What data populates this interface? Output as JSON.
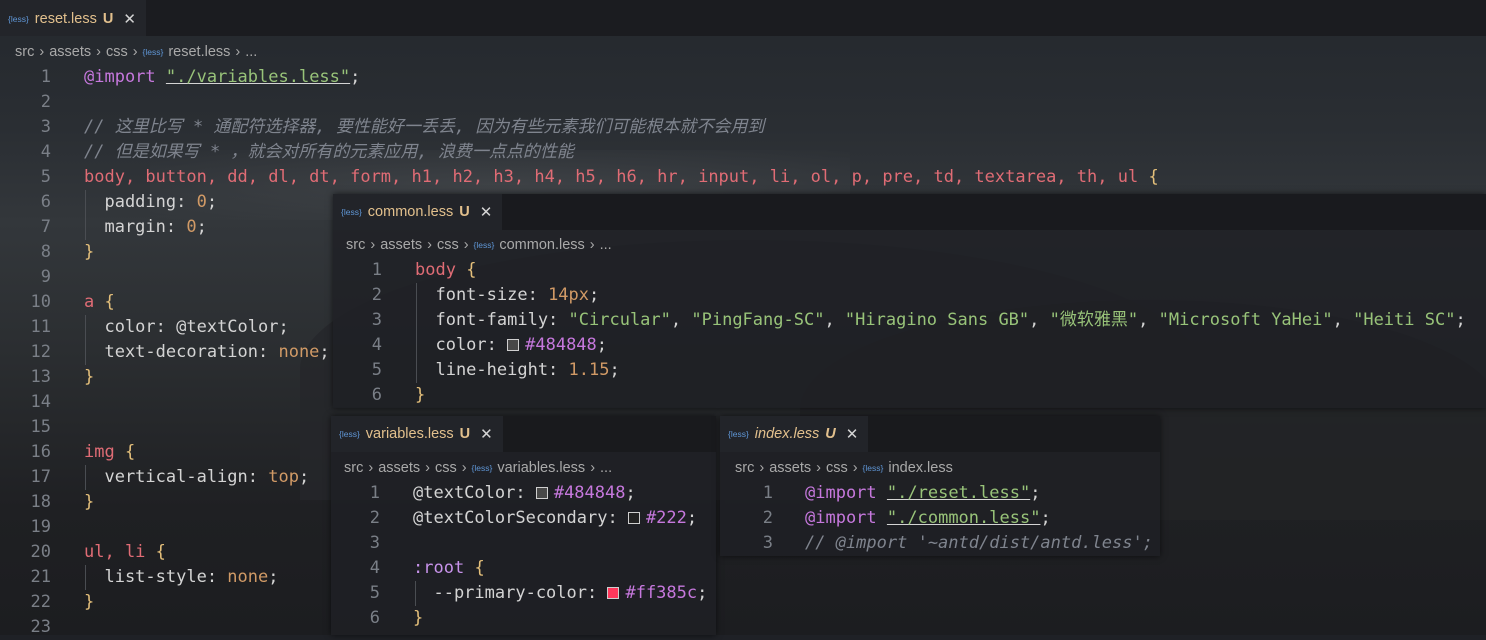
{
  "editors": {
    "main": {
      "tab": {
        "badge": "{less}",
        "name": "reset.less",
        "status": "U",
        "close": "✕"
      },
      "breadcrumb": [
        "src",
        "assets",
        "css",
        "reset.less",
        "..."
      ],
      "lines": [
        {
          "n": "1",
          "code": [
            [
              "at",
              "@import"
            ],
            [
              "p",
              " "
            ],
            [
              "s",
              "\"./variables.less\""
            ],
            [
              "p",
              ";"
            ]
          ]
        },
        {
          "n": "2",
          "code": []
        },
        {
          "n": "3",
          "code": [
            [
              "c",
              "// 这里比写 * 通配符选择器, 要性能好一丢丢, 因为有些元素我们可能根本就不会用到"
            ]
          ]
        },
        {
          "n": "4",
          "code": [
            [
              "c",
              "// 但是如果写 * ，就会对所有的元素应用, 浪费一点点的性能"
            ]
          ]
        },
        {
          "n": "5",
          "code": [
            [
              "k",
              "body, button, dd, dl, dt, form, h1, h2, h3, h4, h5, h6, hr, input, li, ol, p, pre, td, textarea, th, ul"
            ],
            [
              "p",
              " "
            ],
            [
              "b",
              "{"
            ]
          ]
        },
        {
          "n": "6",
          "code": [
            [
              "p",
              "  padding: "
            ],
            [
              "n",
              "0"
            ],
            [
              "p",
              ";"
            ]
          ]
        },
        {
          "n": "7",
          "code": [
            [
              "p",
              "  margin: "
            ],
            [
              "n",
              "0"
            ],
            [
              "p",
              ";"
            ]
          ]
        },
        {
          "n": "8",
          "code": [
            [
              "b",
              "}"
            ]
          ]
        },
        {
          "n": "9",
          "code": []
        },
        {
          "n": "10",
          "code": [
            [
              "k",
              "a"
            ],
            [
              "p",
              " "
            ],
            [
              "b",
              "{"
            ]
          ]
        },
        {
          "n": "11",
          "code": [
            [
              "p",
              "  color: "
            ],
            [
              "p",
              "@textColor"
            ],
            [
              "p",
              ";"
            ]
          ]
        },
        {
          "n": "12",
          "code": [
            [
              "p",
              "  text-decoration: "
            ],
            [
              "v",
              "none"
            ],
            [
              "p",
              ";"
            ]
          ]
        },
        {
          "n": "13",
          "code": [
            [
              "b",
              "}"
            ]
          ]
        },
        {
          "n": "14",
          "code": []
        },
        {
          "n": "15",
          "code": []
        },
        {
          "n": "16",
          "code": [
            [
              "k",
              "img"
            ],
            [
              "p",
              " "
            ],
            [
              "b",
              "{"
            ]
          ]
        },
        {
          "n": "17",
          "code": [
            [
              "p",
              "  vertical-align: "
            ],
            [
              "v",
              "top"
            ],
            [
              "p",
              ";"
            ]
          ]
        },
        {
          "n": "18",
          "code": [
            [
              "b",
              "}"
            ]
          ]
        },
        {
          "n": "19",
          "code": []
        },
        {
          "n": "20",
          "code": [
            [
              "k",
              "ul, li"
            ],
            [
              "p",
              " "
            ],
            [
              "b",
              "{"
            ]
          ]
        },
        {
          "n": "21",
          "code": [
            [
              "p",
              "  list-style: "
            ],
            [
              "v",
              "none"
            ],
            [
              "p",
              ";"
            ]
          ]
        },
        {
          "n": "22",
          "code": [
            [
              "b",
              "}"
            ]
          ]
        },
        {
          "n": "23",
          "code": []
        }
      ]
    },
    "common": {
      "tab": {
        "badge": "{less}",
        "name": "common.less",
        "status": "U",
        "close": "✕"
      },
      "breadcrumb": [
        "src",
        "assets",
        "css",
        "common.less",
        "..."
      ],
      "lines": [
        {
          "n": "1",
          "code": [
            [
              "k",
              "body"
            ],
            [
              "p",
              " "
            ],
            [
              "b",
              "{"
            ]
          ]
        },
        {
          "n": "2",
          "code": [
            [
              "p",
              "  font-size: "
            ],
            [
              "n",
              "14px"
            ],
            [
              "p",
              ";"
            ]
          ]
        },
        {
          "n": "3",
          "code": [
            [
              "p",
              "  font-family: "
            ],
            [
              "s",
              "\"Circular\""
            ],
            [
              "p",
              ", "
            ],
            [
              "s",
              "\"PingFang-SC\""
            ],
            [
              "p",
              ", "
            ],
            [
              "s",
              "\"Hiragino Sans GB\""
            ],
            [
              "p",
              ", "
            ],
            [
              "s",
              "\"微软雅黑\""
            ],
            [
              "p",
              ", "
            ],
            [
              "s",
              "\"Microsoft YaHei\""
            ],
            [
              "p",
              ", "
            ],
            [
              "s",
              "\"Heiti SC\""
            ],
            [
              "p",
              ";"
            ]
          ]
        },
        {
          "n": "4",
          "code": [
            [
              "p",
              "  color: "
            ],
            [
              "sw",
              "#484848"
            ],
            [
              "hx",
              "#484848"
            ],
            [
              "p",
              ";"
            ]
          ]
        },
        {
          "n": "5",
          "code": [
            [
              "p",
              "  line-height: "
            ],
            [
              "n",
              "1.15"
            ],
            [
              "p",
              ";"
            ]
          ]
        },
        {
          "n": "6",
          "code": [
            [
              "b",
              "}"
            ]
          ]
        }
      ]
    },
    "variables": {
      "tab": {
        "badge": "{less}",
        "name": "variables.less",
        "status": "U",
        "close": "✕"
      },
      "breadcrumb": [
        "src",
        "assets",
        "css",
        "variables.less",
        "..."
      ],
      "lines": [
        {
          "n": "1",
          "code": [
            [
              "p",
              "@textColor: "
            ],
            [
              "sw",
              "#484848"
            ],
            [
              "hx",
              "#484848"
            ],
            [
              "p",
              ";"
            ]
          ]
        },
        {
          "n": "2",
          "code": [
            [
              "p",
              "@textColorSecondary: "
            ],
            [
              "sw",
              "#222222"
            ],
            [
              "hx",
              "#222"
            ],
            [
              "p",
              ";"
            ]
          ]
        },
        {
          "n": "3",
          "code": []
        },
        {
          "n": "4",
          "code": [
            [
              "var",
              ":root"
            ],
            [
              "p",
              " "
            ],
            [
              "b",
              "{"
            ]
          ]
        },
        {
          "n": "5",
          "code": [
            [
              "p",
              "  --primary-color: "
            ],
            [
              "sw",
              "#ff385c"
            ],
            [
              "hx",
              "#ff385c"
            ],
            [
              "p",
              ";"
            ]
          ]
        },
        {
          "n": "6",
          "code": [
            [
              "b",
              "}"
            ]
          ]
        }
      ]
    },
    "index": {
      "tab": {
        "badge": "{less}",
        "name": "index.less",
        "status": "U",
        "close": "✕"
      },
      "breadcrumb": [
        "src",
        "assets",
        "css",
        "index.less"
      ],
      "lines": [
        {
          "n": "1",
          "code": [
            [
              "at",
              "@import"
            ],
            [
              "p",
              " "
            ],
            [
              "s",
              "\"./reset.less\""
            ],
            [
              "p",
              ";"
            ]
          ]
        },
        {
          "n": "2",
          "code": [
            [
              "at",
              "@import"
            ],
            [
              "p",
              " "
            ],
            [
              "s",
              "\"./common.less\""
            ],
            [
              "p",
              ";"
            ]
          ]
        },
        {
          "n": "3",
          "code": [
            [
              "c",
              "// @import '~antd/dist/antd.less';"
            ]
          ]
        }
      ]
    }
  },
  "colors": {
    "accent_tab": "#e2c08d",
    "less_badge": "#5f96d6",
    "primary": "#ff385c"
  }
}
